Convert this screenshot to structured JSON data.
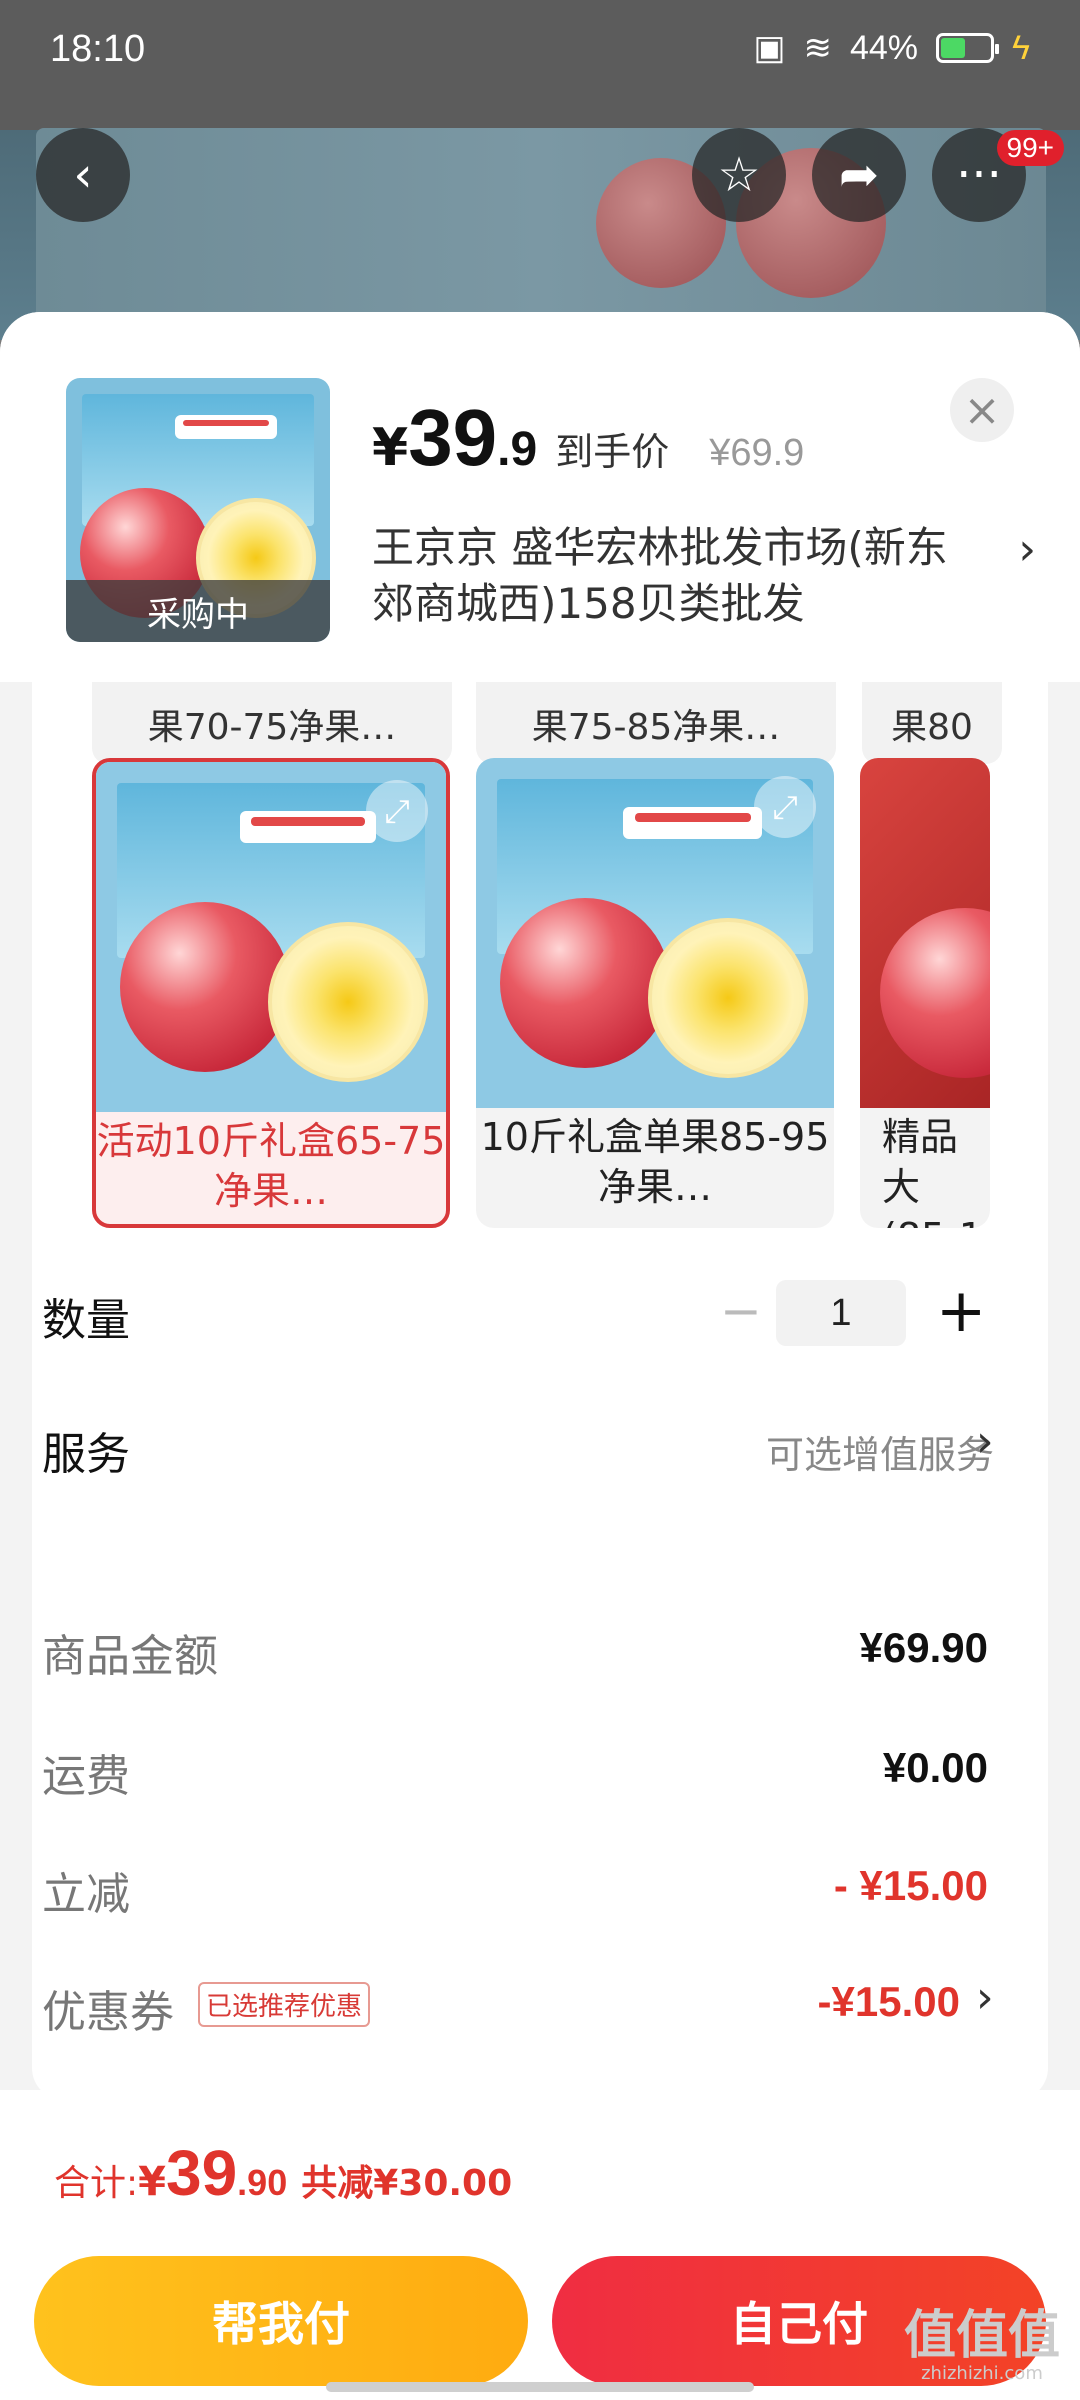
{
  "status_bar": {
    "time": "18:10",
    "battery": "44%"
  },
  "top_nav": {
    "badge": "99+"
  },
  "sheet": {
    "thumb_overlay": "采购中",
    "price": {
      "currency": "¥",
      "integer": "39",
      "decimal": ".9",
      "tag": "到手价",
      "original": "¥69.9"
    },
    "store": "王京京  盛华宏林批发市场(新东郊商城西)158贝类批发"
  },
  "spec_cut": [
    "果70-75净果…",
    "果75-85净果…",
    "果80"
  ],
  "options": [
    {
      "label": "活动10斤礼盒65-75净果…",
      "selected": true
    },
    {
      "label": "10斤礼盒单果85-95净果…",
      "selected": false
    },
    {
      "label": "精品大(85-1",
      "selected": false
    }
  ],
  "quantity": {
    "label": "数量",
    "value": "1",
    "minus": "−",
    "plus": "+"
  },
  "service": {
    "label": "服务",
    "value": "可选增值服务"
  },
  "fees": {
    "goods_label": "商品金额",
    "goods_value": "¥69.90",
    "shipping_label": "运费",
    "shipping_value": "¥0.00",
    "discount_label": "立减",
    "discount_value": "- ¥15.00",
    "coupon_label": "优惠券",
    "coupon_tag": "已选推荐优惠",
    "coupon_value": "-¥15.00"
  },
  "footer": {
    "total_label": "合计:",
    "currency": "¥",
    "total_int": "39",
    "total_dec": ".90",
    "saved": "共减¥30.00",
    "help_pay": "帮我付",
    "self_pay": "自己付"
  },
  "watermark": {
    "main": "值值值",
    "sub": "zhizhizhi.com"
  },
  "colors": {
    "accent_red": "#e0342c",
    "help_btn": "#ffb816",
    "self_btn": "#f1373a"
  }
}
